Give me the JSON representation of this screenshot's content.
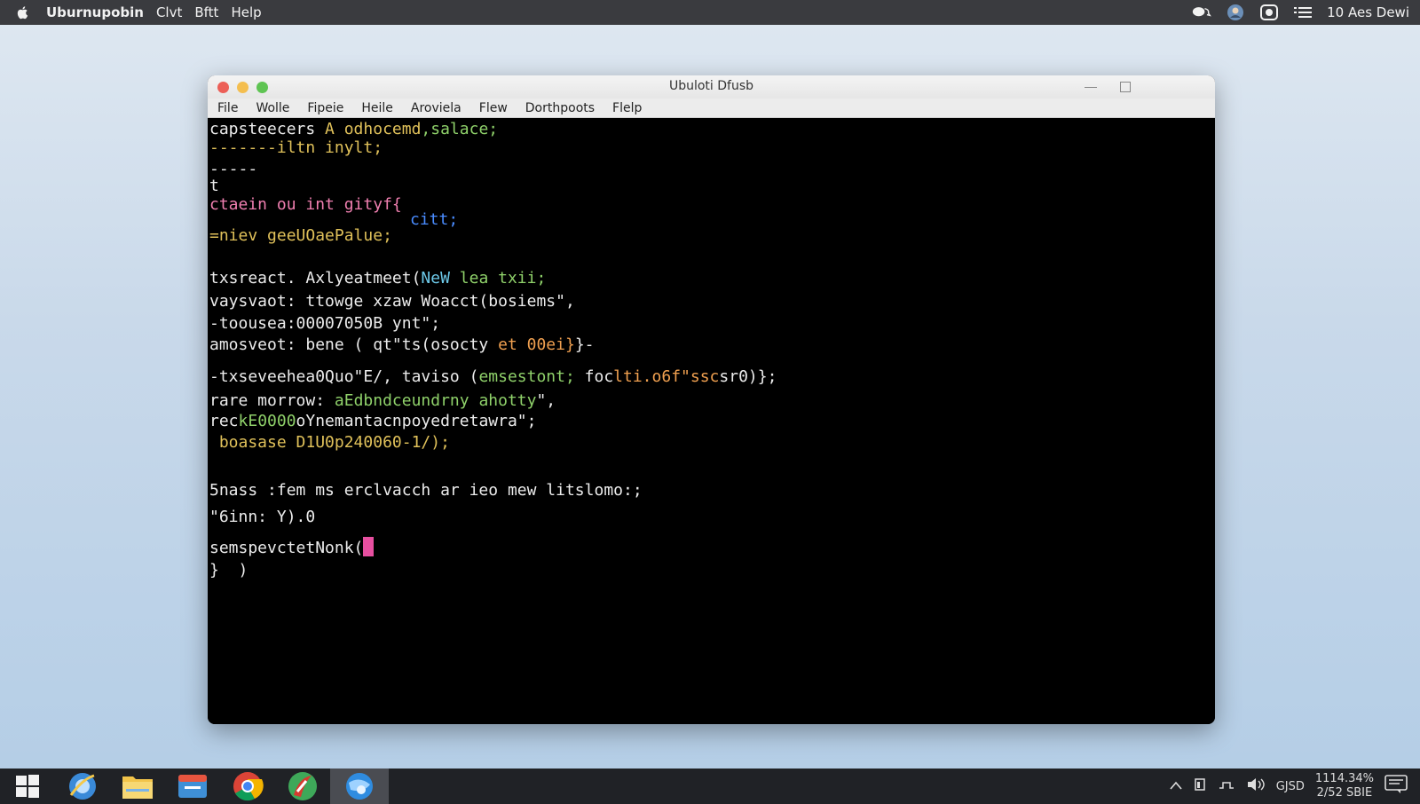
{
  "menubar": {
    "app_name": "Uburnupobin",
    "items": [
      "Clvt",
      "Bftt",
      "Help"
    ],
    "clock": "10 Aes Dewi"
  },
  "window": {
    "title": "Ubuloti Dfusb",
    "menu": [
      "File",
      "Wolle",
      "Fipeie",
      "Heile",
      "Aroviela",
      "Flew",
      "Dorthpoots",
      "Flelp"
    ]
  },
  "terminal": {
    "lines": [
      {
        "a": "capsteecers ",
        "b": "A odhocemd",
        "c": ",salace;",
        "d": ""
      },
      {
        "a": "-------iltn inylt;"
      },
      {
        "a": "-----"
      },
      {
        "a": "t"
      },
      {
        "a": "ctaein ou int gityf{"
      },
      {
        "a": "citt;"
      },
      {
        "a": "=niev geeUOaePalue;"
      },
      {
        "a": "txsreact. Axlyeatmeet(",
        "b": "NeW",
        "c": " lea txii;"
      },
      {
        "a": "vaysvaot: ttowge xzaw Woacct(bosiems\","
      },
      {
        "a": "-toousea:00007050B ynt\";"
      },
      {
        "a": "amosveot: bene ( qt\"ts(osocty ",
        "b": "et 00ei}",
        "c": "}-"
      },
      {
        "a": "-txseveehea0Quo\"E/, taviso (",
        "b": "emsestont;",
        "c": " foc",
        "d": "lti.o6f\"ssc",
        "e": "sr0)};"
      },
      {
        "a": "rare morrow: ",
        "b": "aEdbndceundrny ahotty",
        "c": "\","
      },
      {
        "a": "rec",
        "b": "kE0000",
        "c": "oYnemantacnpoyedretawra\";"
      },
      {
        "a": " boasase D1U0p240060-1/);"
      },
      {
        "a": "5nass :fem ms erclvacch ar ieo mew litslomo:;"
      },
      {
        "a": "\"6inn: Y).0"
      },
      {
        "a": "semspevctetNonk("
      },
      {
        "a": "}  )"
      }
    ]
  },
  "tray": {
    "lang": "GJSD",
    "time": "1114.34%",
    "date": "2/52 SBIE"
  },
  "colors": {
    "desktop_top": "#dfe8f1",
    "desktop_bottom": "#b3cde6",
    "menubar": "#3a3b3f",
    "taskbar": "#202226",
    "cursor": "#e74fa0"
  },
  "icons": {
    "menubar_left": "apple-logo-icon",
    "menubar_right": [
      "chat-bubbles-icon",
      "user-avatar-icon",
      "screen-record-icon",
      "list-menu-icon"
    ],
    "taskbar": [
      "windows-start-icon",
      "internet-explorer-icon",
      "file-explorer-icon",
      "files-app-icon",
      "chrome-icon",
      "red-app-icon",
      "blue-globe-app-icon"
    ],
    "tray": [
      "chevron-up-icon",
      "battery-icon",
      "network-icon",
      "volume-icon",
      "notifications-icon"
    ]
  }
}
